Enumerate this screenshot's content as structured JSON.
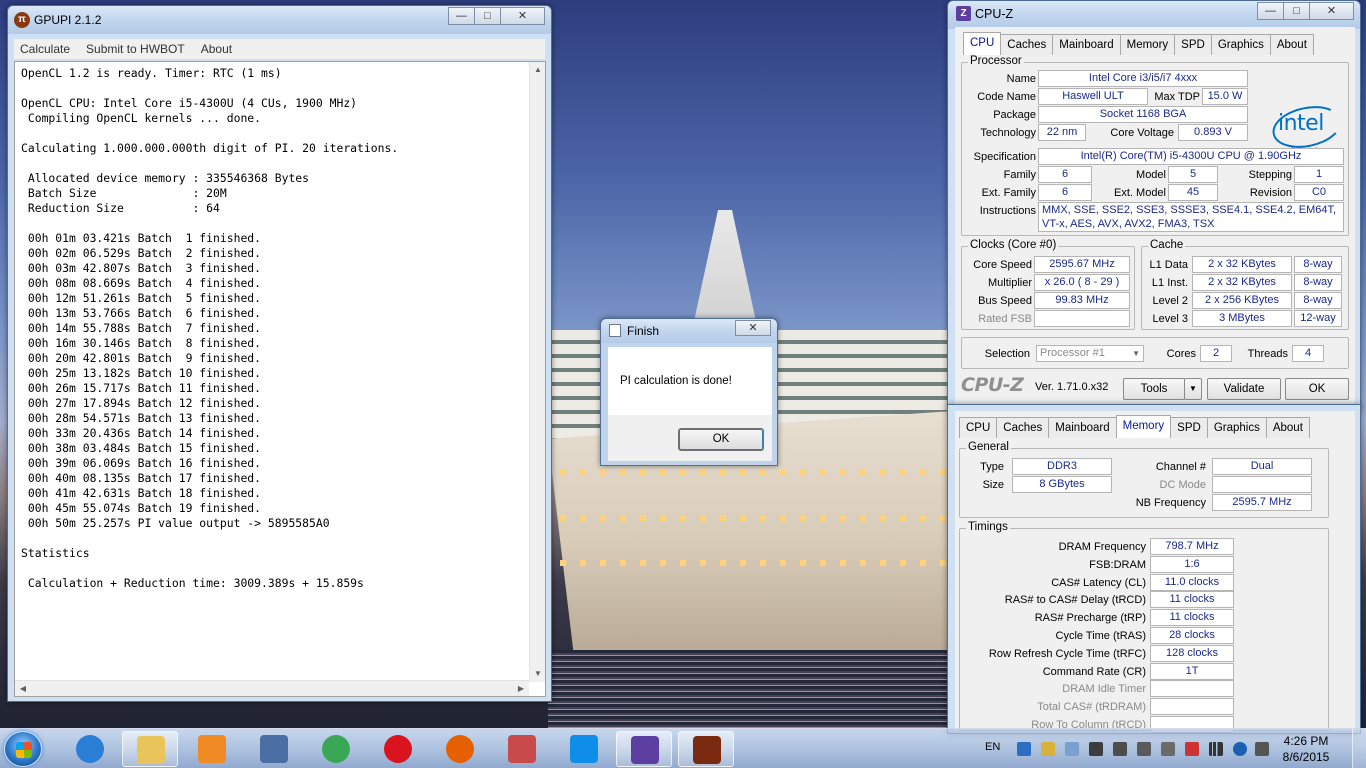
{
  "gpupi": {
    "title": "GPUPI 2.1.2",
    "menu": [
      "Calculate",
      "Submit to HWBOT",
      "About"
    ],
    "log": [
      "OpenCL 1.2 is ready. Timer: RTC (1 ms)",
      "",
      "OpenCL CPU: Intel Core i5-4300U (4 CUs, 1900 MHz)",
      " Compiling OpenCL kernels ... done.",
      "",
      "Calculating 1.000.000.000th digit of PI. 20 iterations.",
      "",
      " Allocated device memory : 335546368 Bytes",
      " Batch Size              : 20M",
      " Reduction Size          : 64",
      "",
      " 00h 01m 03.421s Batch  1 finished.",
      " 00h 02m 06.529s Batch  2 finished.",
      " 00h 03m 42.807s Batch  3 finished.",
      " 00h 08m 08.669s Batch  4 finished.",
      " 00h 12m 51.261s Batch  5 finished.",
      " 00h 13m 53.766s Batch  6 finished.",
      " 00h 14m 55.788s Batch  7 finished.",
      " 00h 16m 30.146s Batch  8 finished.",
      " 00h 20m 42.801s Batch  9 finished.",
      " 00h 25m 13.182s Batch 10 finished.",
      " 00h 26m 15.717s Batch 11 finished.",
      " 00h 27m 17.894s Batch 12 finished.",
      " 00h 28m 54.571s Batch 13 finished.",
      " 00h 33m 20.436s Batch 14 finished.",
      " 00h 38m 03.484s Batch 15 finished.",
      " 00h 39m 06.069s Batch 16 finished.",
      " 00h 40m 08.135s Batch 17 finished.",
      " 00h 41m 42.631s Batch 18 finished.",
      " 00h 45m 55.074s Batch 19 finished.",
      " 00h 50m 25.257s PI value output -> 5895585A0",
      "",
      "Statistics",
      "",
      " Calculation + Reduction time: 3009.389s + 15.859s"
    ]
  },
  "finish_dialog": {
    "title": "Finish",
    "message": "PI calculation is done!",
    "ok_label": "OK"
  },
  "cpuz_cpu": {
    "title": "CPU-Z",
    "tabs": [
      "CPU",
      "Caches",
      "Mainboard",
      "Memory",
      "SPD",
      "Graphics",
      "About"
    ],
    "active_tab": "CPU",
    "processor_group": "Processor",
    "name_label": "Name",
    "name": "Intel Core i3/i5/i7 4xxx",
    "code_name_label": "Code Name",
    "code_name": "Haswell ULT",
    "max_tdp_label": "Max TDP",
    "max_tdp": "15.0 W",
    "package_label": "Package",
    "package": "Socket 1168 BGA",
    "technology_label": "Technology",
    "technology": "22 nm",
    "core_voltage_label": "Core Voltage",
    "core_voltage": "0.893 V",
    "specification_label": "Specification",
    "specification": "Intel(R) Core(TM) i5-4300U CPU @ 1.90GHz",
    "family_label": "Family",
    "family": "6",
    "model_label": "Model",
    "model": "5",
    "stepping_label": "Stepping",
    "stepping": "1",
    "ext_family_label": "Ext. Family",
    "ext_family": "6",
    "ext_model_label": "Ext. Model",
    "ext_model": "45",
    "revision_label": "Revision",
    "revision": "C0",
    "instructions_label": "Instructions",
    "instructions_line1": "MMX, SSE, SSE2, SSE3, SSSE3, SSE4.1, SSE4.2, EM64T,",
    "instructions_line2": "VT-x, AES, AVX, AVX2, FMA3, TSX",
    "logo_word": "intel",
    "logo_inside": "inside",
    "clocks_group": "Clocks (Core #0)",
    "core_speed_label": "Core Speed",
    "core_speed": "2595.67 MHz",
    "multiplier_label": "Multiplier",
    "multiplier": "x 26.0 ( 8 - 29 )",
    "bus_speed_label": "Bus Speed",
    "bus_speed": "99.83 MHz",
    "rated_fsb_label": "Rated FSB",
    "rated_fsb": "",
    "cache_group": "Cache",
    "l1_data_label": "L1 Data",
    "l1_data": "2 x 32 KBytes",
    "l1_data_way": "8-way",
    "l1_inst_label": "L1 Inst.",
    "l1_inst": "2 x 32 KBytes",
    "l1_inst_way": "8-way",
    "level2_label": "Level 2",
    "level2": "2 x 256 KBytes",
    "level2_way": "8-way",
    "level3_label": "Level 3",
    "level3": "3 MBytes",
    "level3_way": "12-way",
    "selection_label": "Selection",
    "selection": "Processor #1",
    "cores_label": "Cores",
    "cores": "2",
    "threads_label": "Threads",
    "threads": "4",
    "brand": "CPU-Z",
    "version": "Ver. 1.71.0.x32",
    "tools_label": "Tools",
    "validate_label": "Validate",
    "ok_label": "OK"
  },
  "cpuz_memory": {
    "tabs": [
      "CPU",
      "Caches",
      "Mainboard",
      "Memory",
      "SPD",
      "Graphics",
      "About"
    ],
    "active_tab": "Memory",
    "general_group": "General",
    "type_label": "Type",
    "type": "DDR3",
    "size_label": "Size",
    "size": "8 GBytes",
    "channel_label": "Channel #",
    "channel": "Dual",
    "dc_mode_label": "DC Mode",
    "dc_mode": "",
    "nb_freq_label": "NB Frequency",
    "nb_freq": "2595.7 MHz",
    "timings_group": "Timings",
    "timings": [
      {
        "label": "DRAM Frequency",
        "value": "798.7 MHz",
        "dim": false
      },
      {
        "label": "FSB:DRAM",
        "value": "1:6",
        "dim": false
      },
      {
        "label": "CAS# Latency (CL)",
        "value": "11.0 clocks",
        "dim": false
      },
      {
        "label": "RAS# to CAS# Delay (tRCD)",
        "value": "11 clocks",
        "dim": false
      },
      {
        "label": "RAS# Precharge (tRP)",
        "value": "11 clocks",
        "dim": false
      },
      {
        "label": "Cycle Time (tRAS)",
        "value": "28 clocks",
        "dim": false
      },
      {
        "label": "Row Refresh Cycle Time (tRFC)",
        "value": "128 clocks",
        "dim": false
      },
      {
        "label": "Command Rate (CR)",
        "value": "1T",
        "dim": false
      },
      {
        "label": "DRAM Idle Timer",
        "value": "",
        "dim": true
      },
      {
        "label": "Total CAS# (tRDRAM)",
        "value": "",
        "dim": true
      },
      {
        "label": "Row To Column (tRCD)",
        "value": "",
        "dim": true
      }
    ]
  },
  "taskbar": {
    "apps": [
      {
        "name": "internet-explorer",
        "color": "#2a7fd4"
      },
      {
        "name": "file-explorer",
        "color": "#e9c45a"
      },
      {
        "name": "media-player",
        "color": "#f08a24"
      },
      {
        "name": "remote-desktop",
        "color": "#4a6fa5"
      },
      {
        "name": "chrome",
        "color": "#3aa757"
      },
      {
        "name": "opera",
        "color": "#d9141e"
      },
      {
        "name": "firefox",
        "color": "#e66000"
      },
      {
        "name": "snipping-tool",
        "color": "#c94a4a"
      },
      {
        "name": "teamviewer",
        "color": "#0e8ee9"
      },
      {
        "name": "cpu-z",
        "color": "#5b3ea0"
      },
      {
        "name": "gpupi",
        "color": "#7a2a10"
      }
    ],
    "language": "EN",
    "time": "4:26 PM",
    "date": "8/6/2015"
  }
}
